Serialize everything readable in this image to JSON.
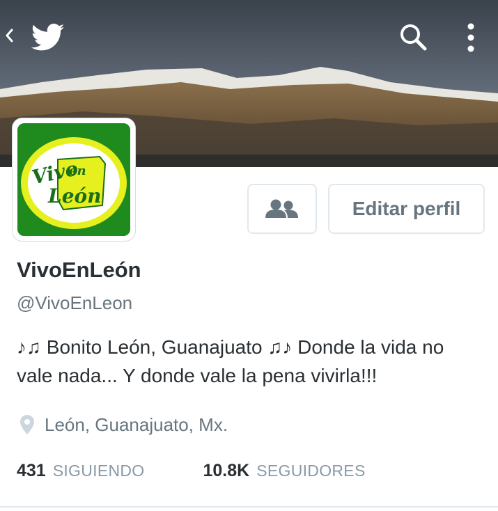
{
  "header": {
    "back_icon": "chevron-left-icon",
    "logo_icon": "twitter-bird-icon",
    "search_icon": "search-icon",
    "menu_icon": "more-vertical-icon"
  },
  "avatar": {
    "logo_text_top": "Vivo",
    "logo_text_en": "en",
    "logo_text_bottom": "León",
    "bg_color": "#1f8a1e",
    "accent_color": "#e6f01e"
  },
  "actions": {
    "follow_icon": "people-icon",
    "edit_label": "Editar perfil"
  },
  "profile": {
    "name": "VivoEnLeón",
    "handle": "@VivoEnLeon",
    "bio": "♪♫ Bonito León, Guanajuato ♫♪  Donde la vida no vale nada... Y donde vale la pena vivirla!!!",
    "location_icon": "location-pin-icon",
    "location": "León, Guanajuato, Mx."
  },
  "stats": {
    "following_count": "431",
    "following_label": "SIGUIENDO",
    "followers_count": "10.8K",
    "followers_label": "SEGUIDORES"
  }
}
